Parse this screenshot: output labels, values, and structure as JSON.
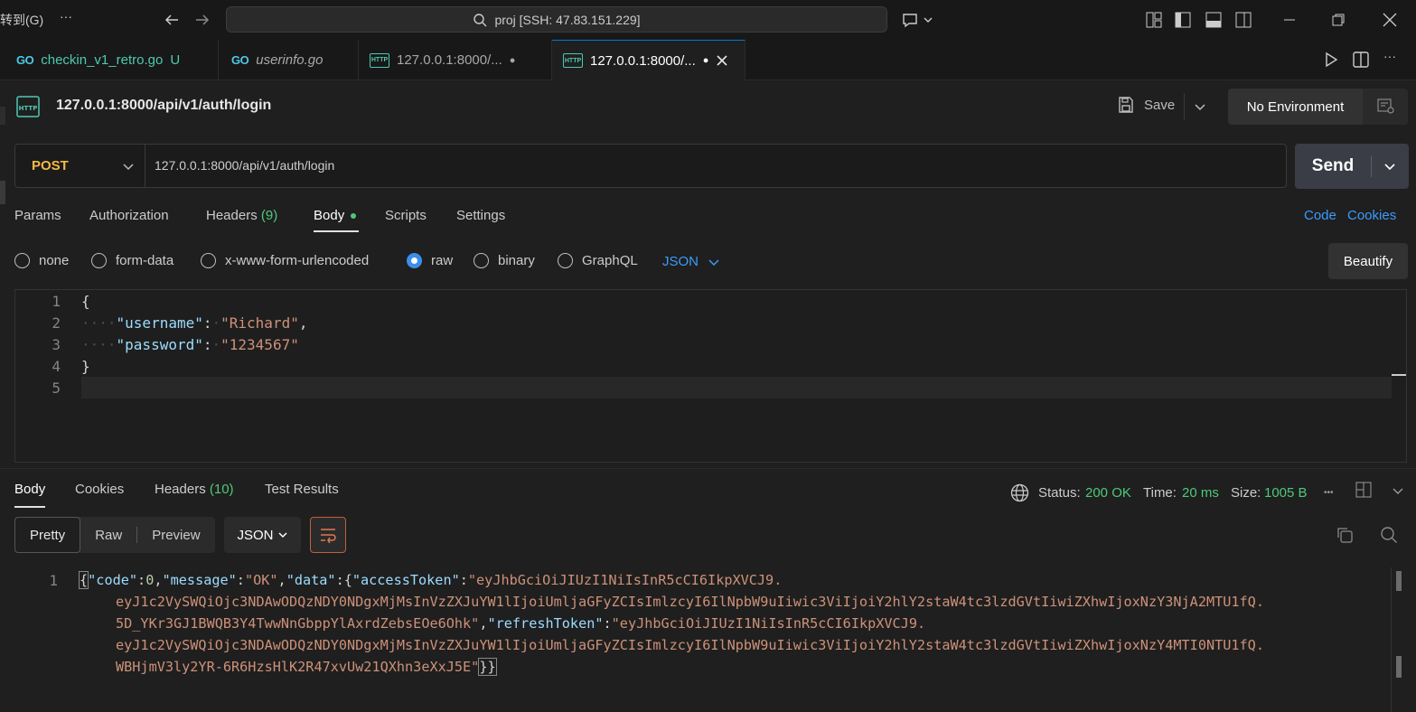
{
  "titlebar": {
    "goto_fragment": "转到(G)",
    "more": "···",
    "command_center": "proj [SSH: 47.83.151.229]"
  },
  "tabs": [
    {
      "label": "checkin_v1_retro.go",
      "status": "U",
      "icon": "go-icon"
    },
    {
      "label": "userinfo.go",
      "status": "",
      "icon": "go-icon"
    },
    {
      "label": "127.0.0.1:8000/...",
      "status": "●",
      "icon": "http-icon"
    },
    {
      "label": "127.0.0.1:8000/...",
      "status": "●",
      "icon": "http-icon"
    }
  ],
  "request": {
    "title": "127.0.0.1:8000/api/v1/auth/login",
    "save_label": "Save",
    "environment": "No Environment",
    "method": "POST",
    "url": "127.0.0.1:8000/api/v1/auth/login",
    "send_label": "Send"
  },
  "subtabs": {
    "params": "Params",
    "authorization": "Authorization",
    "headers": "Headers",
    "headers_count": "(9)",
    "body": "Body",
    "scripts": "Scripts",
    "settings": "Settings",
    "code": "Code",
    "cookies": "Cookies"
  },
  "body_types": {
    "none": "none",
    "form_data": "form-data",
    "urlencoded": "x-www-form-urlencoded",
    "raw": "raw",
    "binary": "binary",
    "graphql": "GraphQL",
    "format": "JSON",
    "selected": "raw",
    "beautify": "Beautify"
  },
  "editor": {
    "line_numbers": [
      "1",
      "2",
      "3",
      "4",
      "5"
    ],
    "open_brace": "{",
    "close_brace": "}",
    "dots": "····",
    "username_key": "\"username\"",
    "username_val": "\"Richard\"",
    "password_key": "\"password\"",
    "password_val": "\"1234567\"",
    "colon": ":",
    "comma": ","
  },
  "response": {
    "tabs": {
      "body": "Body",
      "cookies": "Cookies",
      "headers": "Headers",
      "headers_count": "(10)",
      "test_results": "Test Results"
    },
    "status_label": "Status:",
    "status_value": "200 OK",
    "time_label": "Time:",
    "time_value": "20 ms",
    "size_label": "Size:",
    "size_value": "1005 B",
    "more": "•••",
    "views": {
      "pretty": "Pretty",
      "raw": "Raw",
      "preview": "Preview",
      "format": "JSON"
    },
    "line_number": "1",
    "lines": {
      "p_open": "{",
      "k_code": "\"code\"",
      "v_code": "0",
      "k_message": "\"message\"",
      "v_message": "\"OK\"",
      "k_data": "\"data\"",
      "k_access": "\"accessToken\"",
      "v_access_1": "\"eyJhbGciOiJIUzI1NiIsInR5cCI6IkpXVCJ9.",
      "v_access_2": "eyJ1c2VySWQiOjc3NDAwODQzNDY0NDgxMjMsInVzZXJuYW1lIjoiUmljaGFyZCIsImlzcyI6IlNpbW9uIiwic3ViIjoiY2hlY2staW4tc3lzdGVtIiwiZXhwIjoxNzY3NjA2MTU1fQ.",
      "v_access_3": "5D_YKr3GJ1BWQB3Y4TwwNnGbppYlAxrdZebsEOe6Ohk\"",
      "k_refresh": "\"refreshToken\"",
      "v_refresh_1": "\"eyJhbGciOiJIUzI1NiIsInR5cCI6IkpXVCJ9.",
      "v_refresh_2": "eyJ1c2VySWQiOjc3NDAwODQzNDY0NDgxMjMsInVzZXJuYW1lIjoiUmljaGFyZCIsImlzcyI6IlNpbW9uIiwic3ViIjoiY2hlY2staW4tc3lzdGVtIiwiZXhwIjoxNzY4MTI0NTU1fQ.",
      "v_refresh_3": "WBHjmV3ly2YR-6R6HzsHlK2R47xvUw21QXhn3eXxJ5E\"",
      "p_close": "}}"
    }
  },
  "colors": {
    "accent": "#3b9bff",
    "method": "#f5b947",
    "success": "#4ec97a",
    "json_key": "#9cdcfe",
    "json_string": "#ce9178"
  }
}
